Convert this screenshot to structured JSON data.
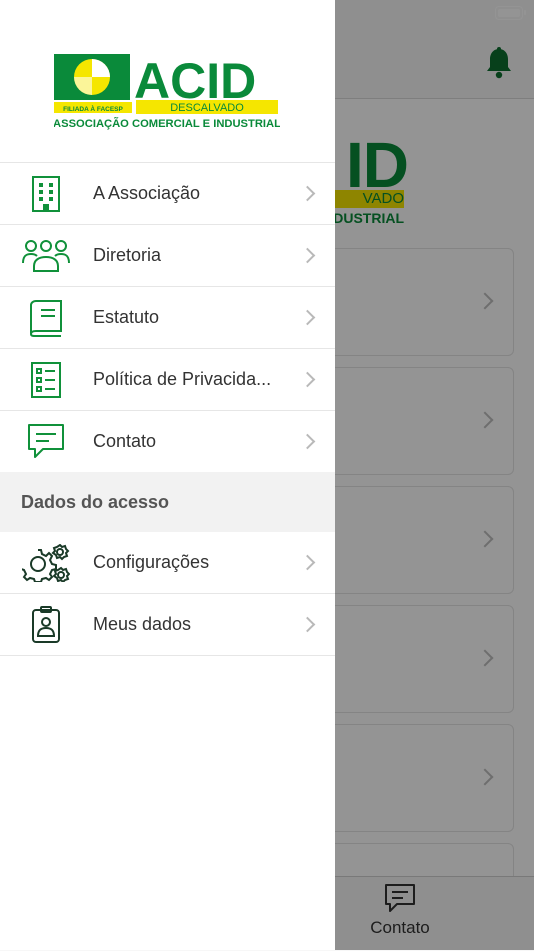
{
  "colors": {
    "brand_green": "#0a8a3a",
    "brand_yellow": "#f5e600",
    "icon_green": "#10913a"
  },
  "logo": {
    "name": "ACID",
    "tagline": "FILIADA À FACESP",
    "city": "DESCALVADO",
    "full_name": "ASSOCIAÇÃO COMERCIAL E INDUSTRIAL"
  },
  "drawer": {
    "items": [
      {
        "label": "A Associação",
        "icon": "building-icon"
      },
      {
        "label": "Diretoria",
        "icon": "group-icon"
      },
      {
        "label": "Estatuto",
        "icon": "book-icon"
      },
      {
        "label": "Política de Privacida...",
        "icon": "checklist-icon"
      },
      {
        "label": "Contato",
        "icon": "chat-icon"
      }
    ],
    "section_title": "Dados do acesso",
    "access_items": [
      {
        "label": "Configurações",
        "icon": "gears-icon"
      },
      {
        "label": "Meus dados",
        "icon": "id-badge-icon"
      }
    ]
  },
  "background": {
    "logo_big": "ID",
    "logo_bar": "VADO",
    "logo_sub": "NDUSTRIAL",
    "tab_label": "Contato",
    "bell_icon": "bell-icon"
  }
}
